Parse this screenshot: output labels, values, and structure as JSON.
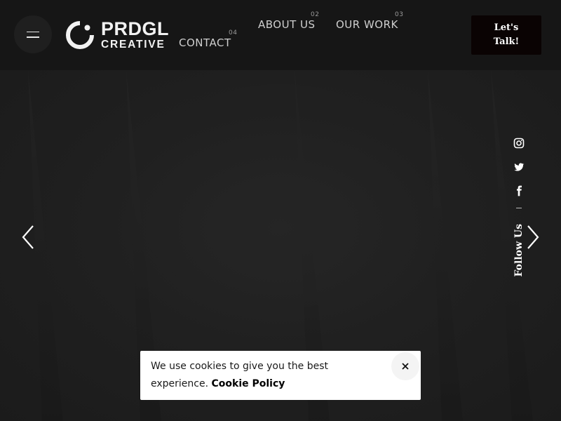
{
  "header": {
    "menu_icon": "hamburger-icon",
    "logo": {
      "line1": "PRDGL",
      "line2": "CREATIVE"
    },
    "nav": [
      {
        "label": "ABOUT US",
        "number": "02"
      },
      {
        "label": "OUR WORK",
        "number": "03"
      },
      {
        "label": "CONTACT",
        "number": "04"
      }
    ],
    "cta": {
      "line1": "Let's",
      "line2": "Talk!"
    }
  },
  "hero": {
    "prev_icon": "chevron-left-icon",
    "next_icon": "chevron-right-icon"
  },
  "social": {
    "icons": [
      "instagram-icon",
      "twitter-icon",
      "facebook-icon"
    ],
    "follow_label": "Follow Us"
  },
  "cookie": {
    "text": "We use cookies to give you the best experience.",
    "link": "Cookie Policy",
    "close_icon": "close-icon"
  },
  "colors": {
    "header_bg": "#161616",
    "hero_bg": "#202020",
    "cta_bg": "#0a0303",
    "nav_text": "#cfcfcf",
    "cookie_bg": "#ffffff"
  }
}
